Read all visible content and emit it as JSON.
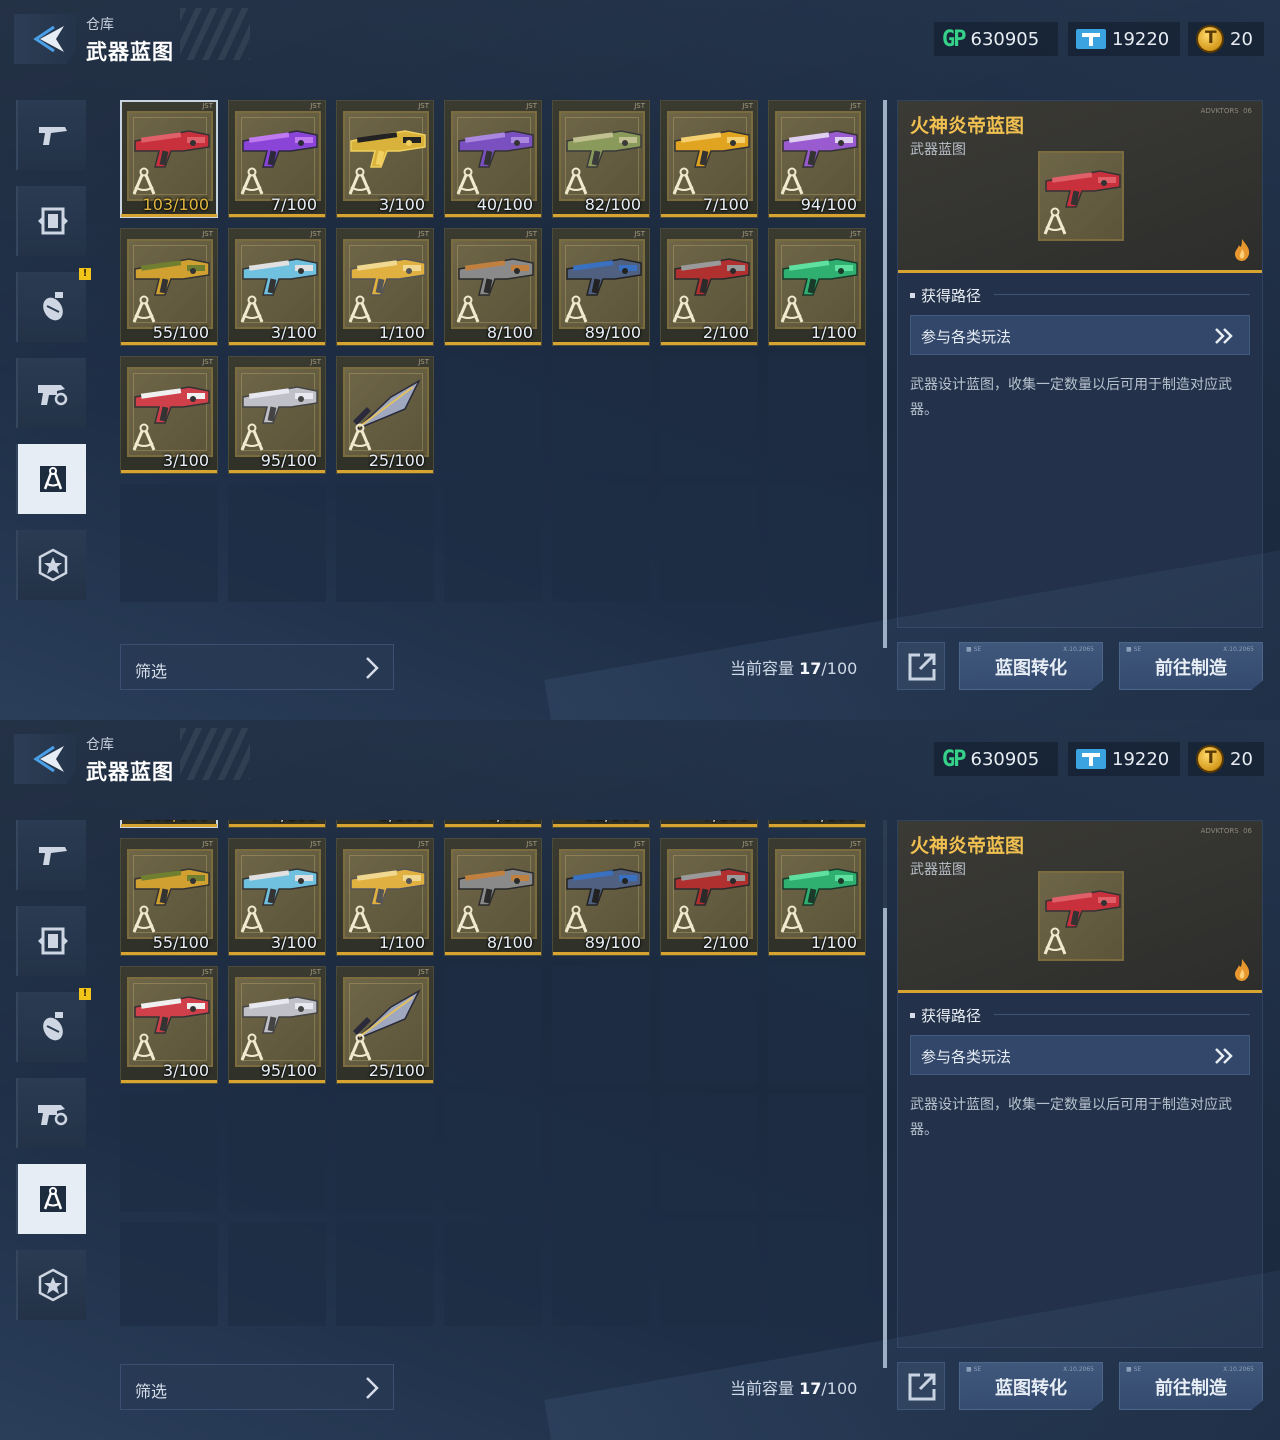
{
  "header": {
    "breadcrumb": "仓库",
    "title": "武器蓝图"
  },
  "currency": {
    "gp_icon": "GP",
    "gp_value": "630905",
    "ticket_value": "19220",
    "coin_value": "20"
  },
  "sidebar": {
    "tabs": [
      {
        "icon": "pistol-icon"
      },
      {
        "icon": "frame-icon"
      },
      {
        "icon": "grenade-icon",
        "badge": "!"
      },
      {
        "icon": "weapon-parts-icon"
      },
      {
        "icon": "blueprint-icon",
        "active": true
      },
      {
        "icon": "star-badge-icon"
      }
    ]
  },
  "items": [
    {
      "count": "103/100",
      "gun": "red-heavy",
      "selected": true
    },
    {
      "count": "7/100",
      "gun": "purple-sniper"
    },
    {
      "count": "3/100",
      "gun": "gold-rifle"
    },
    {
      "count": "40/100",
      "gun": "purple-spear"
    },
    {
      "count": "82/100",
      "gun": "camo-smg"
    },
    {
      "count": "7/100",
      "gun": "gold-sniper"
    },
    {
      "count": "94/100",
      "gun": "violet-rifle"
    },
    {
      "count": "55/100",
      "gun": "gold-pistol"
    },
    {
      "count": "3/100",
      "gun": "cyan-pistol"
    },
    {
      "count": "1/100",
      "gun": "gold-pistol2"
    },
    {
      "count": "8/100",
      "gun": "grey-shotgun"
    },
    {
      "count": "89/100",
      "gun": "blue-rifle"
    },
    {
      "count": "2/100",
      "gun": "red-rifle"
    },
    {
      "count": "1/100",
      "gun": "green-crossbow"
    },
    {
      "count": "3/100",
      "gun": "red-smg"
    },
    {
      "count": "95/100",
      "gun": "silver-cannon"
    },
    {
      "count": "25/100",
      "gun": "dagger"
    }
  ],
  "footer": {
    "filter_label": "筛选",
    "capacity_label": "当前容量",
    "capacity_used": "17",
    "capacity_total": "/100"
  },
  "detail": {
    "name": "火神炎帝蓝图",
    "type": "武器蓝图",
    "source_heading": "获得路径",
    "source_button": "参与各类玩法",
    "description": "武器设计蓝图，收集一定数量以后可用于制造对应武器。"
  },
  "actions": {
    "convert": "蓝图转化",
    "forge": "前往制造"
  },
  "colors": {
    "accent_gold": "#d8a431",
    "item_name": "#f0c050",
    "gp_green": "#35d28a"
  }
}
